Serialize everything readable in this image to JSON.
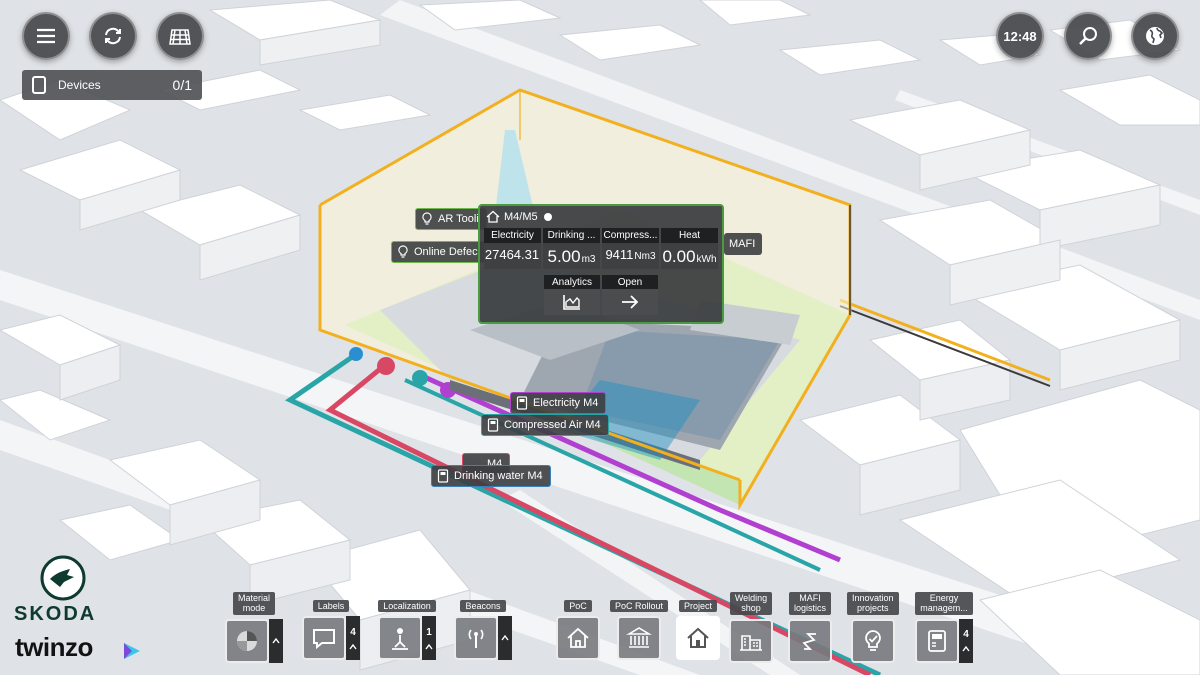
{
  "top_left": {
    "menu_icon": "menu-icon",
    "sync_icon": "sync-icon",
    "grid_icon": "grid-icon"
  },
  "devices": {
    "label": "Devices",
    "count": "0/1"
  },
  "top_right": {
    "time": "12:48",
    "search_icon": "search-icon",
    "globe_icon": "globe-icon"
  },
  "tags": {
    "ar_tooling": "AR Tooli",
    "online_defect": "Online Defec",
    "mafi": "MAFI",
    "electricity": "Electricity M4",
    "compressed_air": "Compressed Air M4",
    "drinking_water": "Drinking water M4",
    "hidden": "M4"
  },
  "panel": {
    "title": "M4/M5",
    "metrics": [
      {
        "header": "Electricity",
        "value": "27464.31",
        "unit": ""
      },
      {
        "header": "Drinking ...",
        "value": "5.00",
        "unit": "m3"
      },
      {
        "header": "Compress...",
        "value": "9411",
        "unit": "Nm3"
      },
      {
        "header": "Heat",
        "value": "0.00",
        "unit": "kWh"
      }
    ],
    "actions": [
      {
        "label": "Analytics",
        "icon": "analytics-icon"
      },
      {
        "label": "Open",
        "icon": "arrow-right-icon"
      }
    ]
  },
  "toolbar": {
    "material_mode": "Material\nmode",
    "labels": "Labels",
    "labels_count": "4",
    "localization": "Localization",
    "localization_count": "1",
    "beacons": "Beacons",
    "poc": "PoC",
    "poc_rollout": "PoC Rollout",
    "project": "Project",
    "welding_shop": "Welding\nshop",
    "mafi_logistics": "MAFI\nlogistics",
    "innovation_projects": "Innovation\nprojects",
    "energy_management": "Energy\nmanagem...",
    "energy_count": "4"
  },
  "brand": {
    "name": "SKODA",
    "product": "twinzo"
  },
  "colors": {
    "highlight": "#f2b01e",
    "electric_line": "#b13fd0",
    "air_line": "#29a5a8",
    "water_line": "#d84864",
    "panel_border": "#4a9a3f"
  }
}
